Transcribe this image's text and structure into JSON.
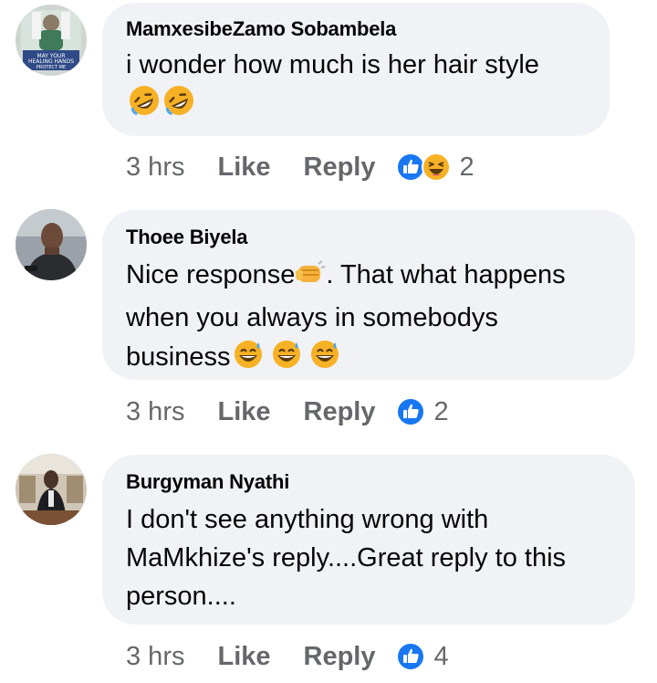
{
  "comments": [
    {
      "author": "MamxesibeZamo Sobambela",
      "text": "i wonder how much is her hair style",
      "avatar_caption": "MAY YOUR HEALING HANDS PROTECT ME",
      "time": "3 hrs",
      "like_label": "Like",
      "reply_label": "Reply",
      "reactions": [
        "like",
        "haha"
      ],
      "reaction_count": "2"
    },
    {
      "author": "Thoee Biyela",
      "text_line1": "Nice response",
      "text_line1b": ". That what happens",
      "text_line2": "when you always in somebodys",
      "text_line3": "business",
      "time": "3 hrs",
      "like_label": "Like",
      "reply_label": "Reply",
      "reactions": [
        "like"
      ],
      "reaction_count": "2"
    },
    {
      "author": "Burgyman Nyathi",
      "text_line1": "I don't see anything wrong with",
      "text_line2": "MaMkhize's reply....Great reply to this",
      "text_line3": "person....",
      "time": "3 hrs",
      "like_label": "Like",
      "reply_label": "Reply",
      "reactions": [
        "like"
      ],
      "reaction_count": "4"
    }
  ],
  "colors": {
    "bubble": "#f0f2f5",
    "meta_text": "#65676b",
    "like_blue": "#1877f2",
    "haha_yellow": "#f7b125"
  }
}
